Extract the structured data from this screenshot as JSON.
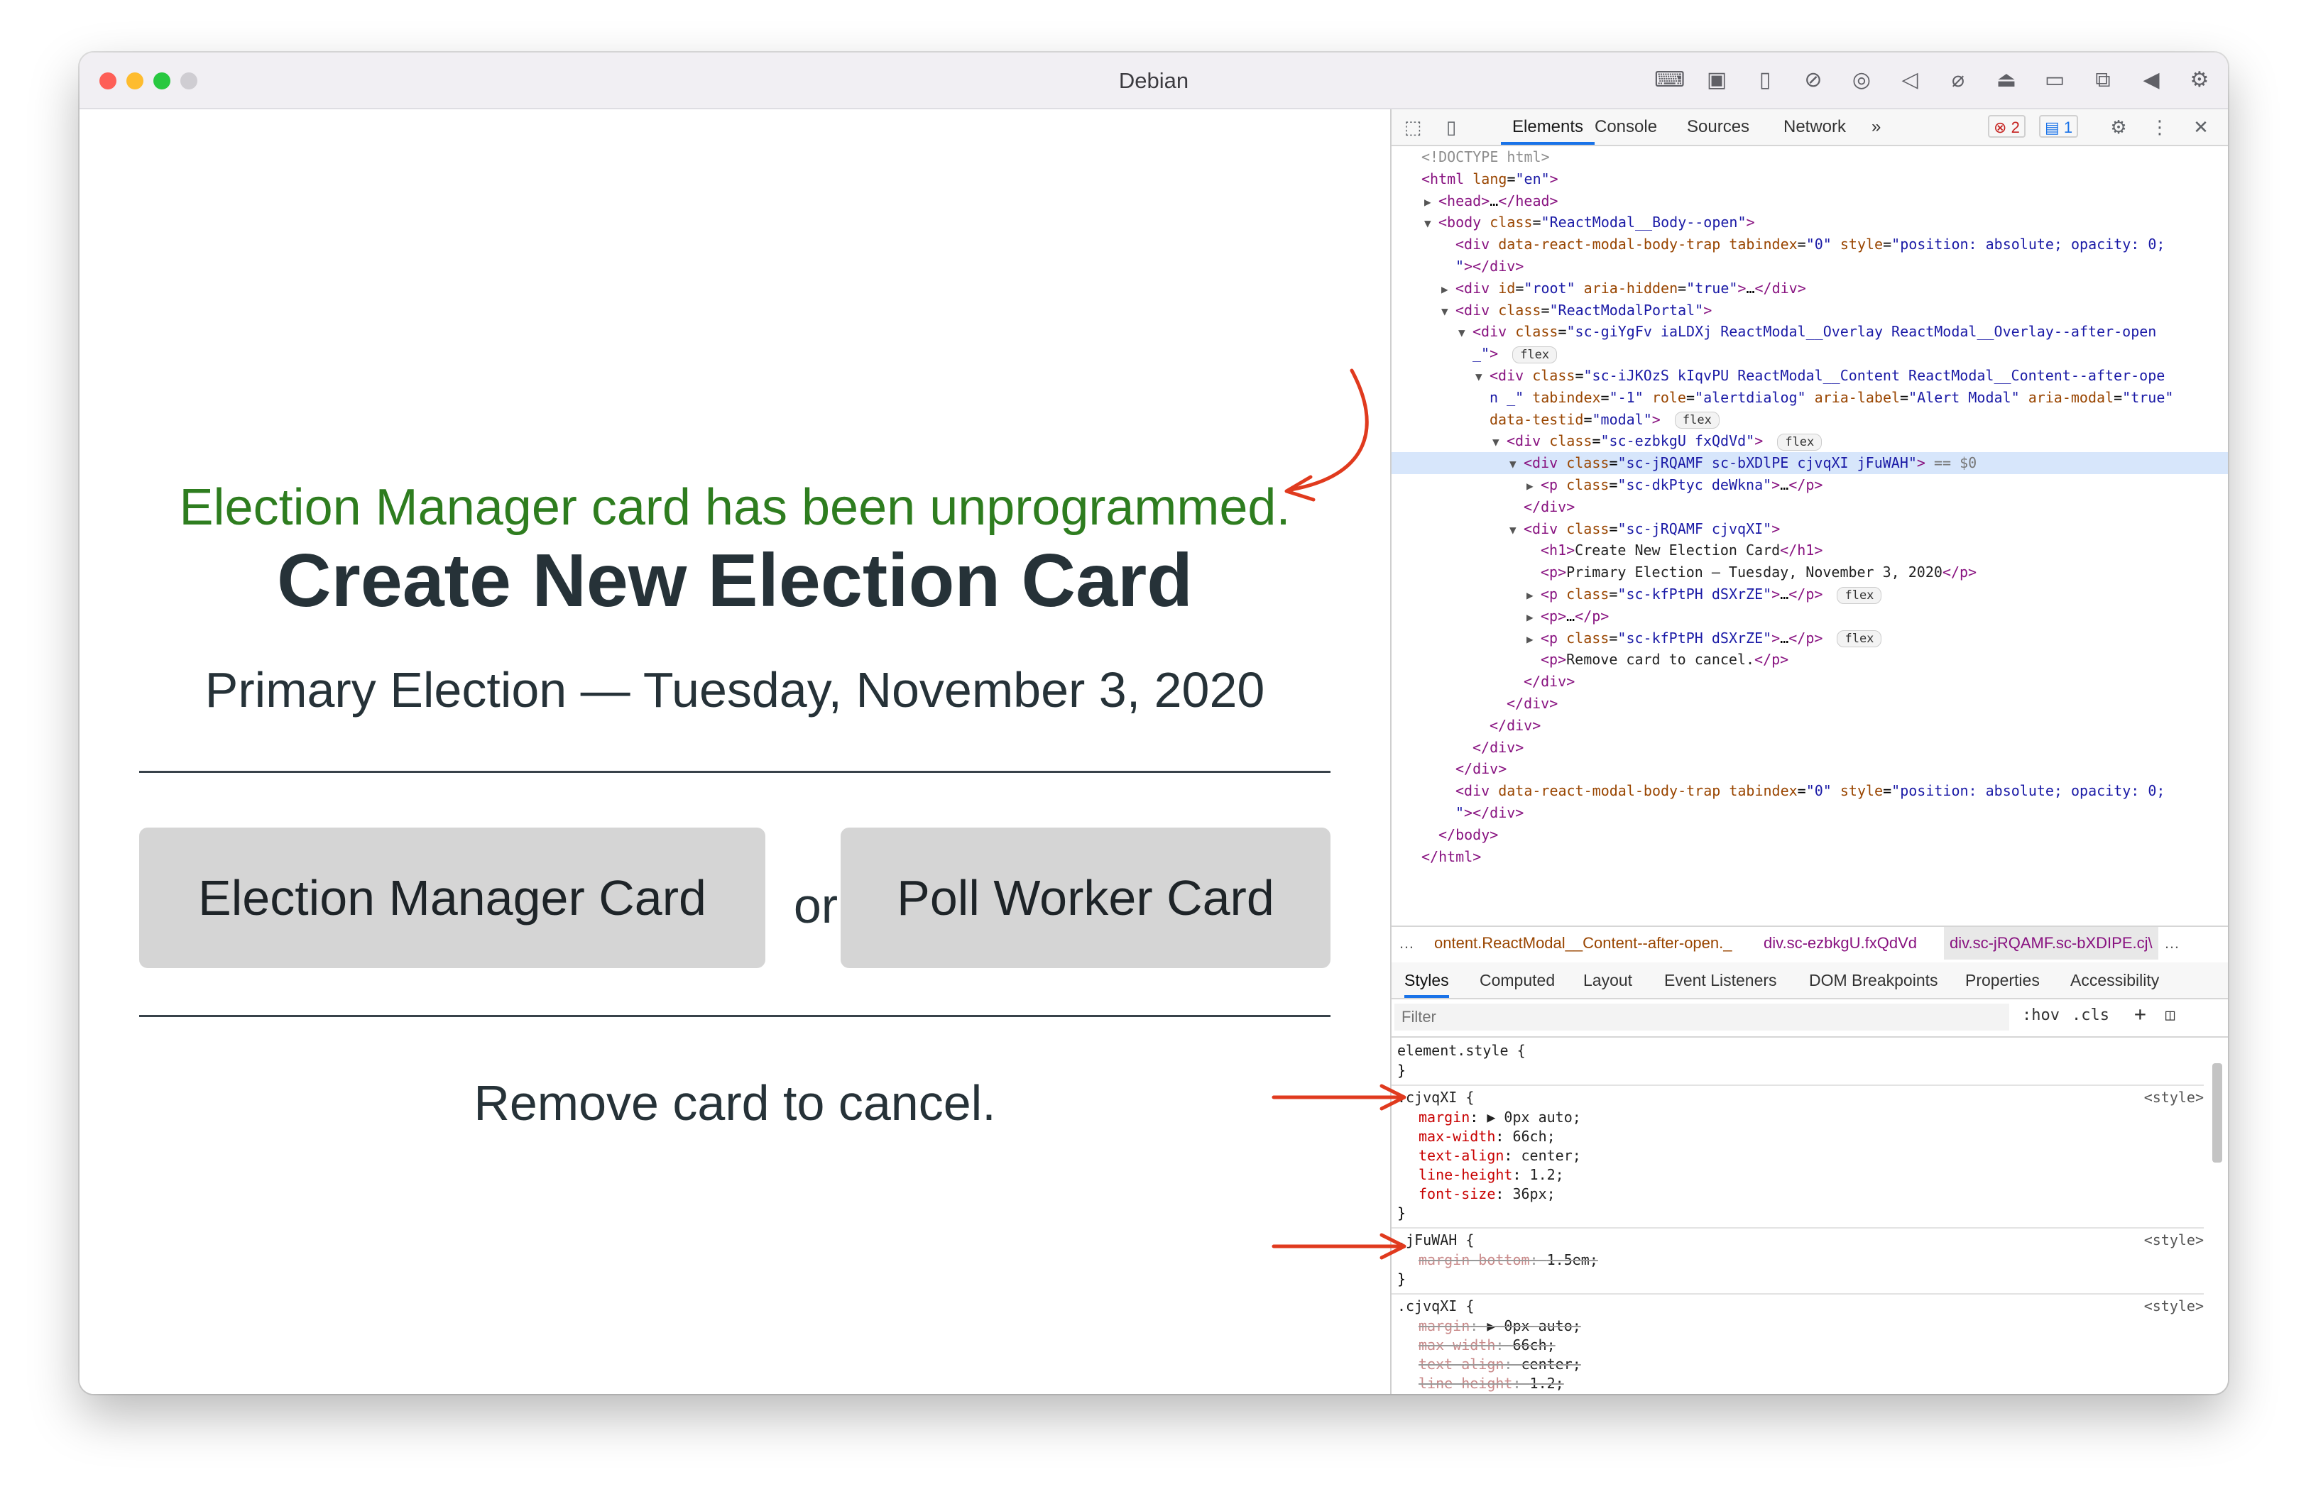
{
  "window": {
    "title": "Debian"
  },
  "titlebar_icons": [
    "keyboard-icon",
    "cpu-icon",
    "usb-icon",
    "display-off-icon",
    "network-icon",
    "speaker-icon",
    "microphone-off-icon",
    "drive-icon",
    "camera-off-icon",
    "screen-share-icon",
    "arrow-left-icon",
    "settings-icon"
  ],
  "app": {
    "success_message": "Election Manager card has been unprogrammed.",
    "heading": "Create New Election Card",
    "subtitle": "Primary Election — Tuesday, November 3, 2020",
    "election_manager_button": "Election Manager Card",
    "or_label": "or",
    "poll_worker_button": "Poll Worker Card",
    "cancel_instruction": "Remove card to cancel.",
    "success_color": "#2e7d1f",
    "button_bg": "#d5d5d5",
    "annotation_arrow_color": "#e03a1e"
  },
  "devtools": {
    "tabs": [
      "Elements",
      "Console",
      "Sources",
      "Network",
      "»"
    ],
    "active_tab": "Elements",
    "error_count": "2",
    "message_count": "1",
    "dom_lines": [
      {
        "indent": 0,
        "tri": "",
        "html": "<span class=\"tk-com\">&lt;!DOCTYPE html&gt;</span>"
      },
      {
        "indent": 0,
        "tri": "",
        "html": "<span class=\"tk-tag\">&lt;html</span> <span class=\"tk-attr\">lang</span>=<span class=\"tk-val\">\"en\"</span><span class=\"tk-tag\">&gt;</span>"
      },
      {
        "indent": 1,
        "tri": "▶",
        "html": "<span class=\"tk-tag\">&lt;head&gt;</span>…<span class=\"tk-tag\">&lt;/head&gt;</span>"
      },
      {
        "indent": 1,
        "tri": "▼",
        "html": "<span class=\"tk-tag\">&lt;body</span> <span class=\"tk-attr\">class</span>=<span class=\"tk-val\">\"ReactModal__Body--open\"</span><span class=\"tk-tag\">&gt;</span>"
      },
      {
        "indent": 2,
        "tri": "",
        "html": "<span class=\"tk-tag\">&lt;div</span> <span class=\"tk-attr\">data-react-modal-body-trap</span> <span class=\"tk-attr\">tabindex</span>=<span class=\"tk-val\">\"0\"</span> <span class=\"tk-attr\">style</span>=<span class=\"tk-val\">\"position: absolute; opacity: 0;</span>"
      },
      {
        "indent": 2,
        "tri": "",
        "html": "<span class=\"tk-val\">\"</span><span class=\"tk-tag\">&gt;&lt;/div&gt;</span>"
      },
      {
        "indent": 2,
        "tri": "▶",
        "html": "<span class=\"tk-tag\">&lt;div</span> <span class=\"tk-attr\">id</span>=<span class=\"tk-val\">\"root\"</span> <span class=\"tk-attr\">aria-hidden</span>=<span class=\"tk-val\">\"true\"</span><span class=\"tk-tag\">&gt;</span>…<span class=\"tk-tag\">&lt;/div&gt;</span>"
      },
      {
        "indent": 2,
        "tri": "▼",
        "html": "<span class=\"tk-tag\">&lt;div</span> <span class=\"tk-attr\">class</span>=<span class=\"tk-val\">\"ReactModalPortal\"</span><span class=\"tk-tag\">&gt;</span>"
      },
      {
        "indent": 3,
        "tri": "▼",
        "html": "<span class=\"tk-tag\">&lt;div</span> <span class=\"tk-attr\">class</span>=<span class=\"tk-val\">\"sc-giYgFv iaLDXj ReactModal__Overlay ReactModal__Overlay--after-open</span>"
      },
      {
        "indent": 3,
        "tri": "",
        "html": "<span class=\"tk-val\">_\"</span><span class=\"tk-tag\">&gt;</span> <span class=\"flex-pill\">flex</span>"
      },
      {
        "indent": 4,
        "tri": "▼",
        "html": "<span class=\"tk-tag\">&lt;div</span> <span class=\"tk-attr\">class</span>=<span class=\"tk-val\">\"sc-iJKOzS kIqvPU ReactModal__Content ReactModal__Content--after-ope</span>"
      },
      {
        "indent": 4,
        "tri": "",
        "html": "<span class=\"tk-val\">n _\"</span> <span class=\"tk-attr\">tabindex</span>=<span class=\"tk-val\">\"-1\"</span> <span class=\"tk-attr\">role</span>=<span class=\"tk-val\">\"alertdialog\"</span> <span class=\"tk-attr\">aria-label</span>=<span class=\"tk-val\">\"Alert Modal\"</span> <span class=\"tk-attr\">aria-modal</span>=<span class=\"tk-val\">\"true\"</span>"
      },
      {
        "indent": 4,
        "tri": "",
        "html": "<span class=\"tk-attr\">data-testid</span>=<span class=\"tk-val\">\"modal\"</span><span class=\"tk-tag\">&gt;</span> <span class=\"flex-pill\">flex</span>"
      },
      {
        "indent": 5,
        "tri": "▼",
        "html": "<span class=\"tk-tag\">&lt;div</span> <span class=\"tk-attr\">class</span>=<span class=\"tk-val\">\"sc-ezbkgU fxQdVd\"</span><span class=\"tk-tag\">&gt;</span> <span class=\"flex-pill\">flex</span>"
      },
      {
        "indent": 6,
        "tri": "▼",
        "sel": true,
        "html": "<span class=\"tk-tag\">&lt;div</span> <span class=\"tk-attr\">class</span>=<span class=\"tk-val\">\"sc-jRQAMF sc-bXDlPE cjvqXI jFuWAH\"</span><span class=\"tk-tag\">&gt;</span> <span class=\"sel-mark\">== $0</span>"
      },
      {
        "indent": 7,
        "tri": "▶",
        "html": "<span class=\"tk-tag\">&lt;p</span> <span class=\"tk-attr\">class</span>=<span class=\"tk-val\">\"sc-dkPtyc deWkna\"</span><span class=\"tk-tag\">&gt;</span>…<span class=\"tk-tag\">&lt;/p&gt;</span>"
      },
      {
        "indent": 6,
        "tri": "",
        "html": "<span class=\"tk-tag\">&lt;/div&gt;</span>"
      },
      {
        "indent": 6,
        "tri": "▼",
        "html": "<span class=\"tk-tag\">&lt;div</span> <span class=\"tk-attr\">class</span>=<span class=\"tk-val\">\"sc-jRQAMF cjvqXI\"</span><span class=\"tk-tag\">&gt;</span>"
      },
      {
        "indent": 7,
        "tri": "",
        "html": "<span class=\"tk-tag\">&lt;h1&gt;</span><span class=\"tk-text\">Create New Election Card</span><span class=\"tk-tag\">&lt;/h1&gt;</span>"
      },
      {
        "indent": 7,
        "tri": "",
        "html": "<span class=\"tk-tag\">&lt;p&gt;</span><span class=\"tk-text\">Primary Election — Tuesday, November 3, 2020</span><span class=\"tk-tag\">&lt;/p&gt;</span>"
      },
      {
        "indent": 7,
        "tri": "▶",
        "html": "<span class=\"tk-tag\">&lt;p</span> <span class=\"tk-attr\">class</span>=<span class=\"tk-val\">\"sc-kfPtPH dSXrZE\"</span><span class=\"tk-tag\">&gt;</span>…<span class=\"tk-tag\">&lt;/p&gt;</span> <span class=\"flex-pill\">flex</span>"
      },
      {
        "indent": 7,
        "tri": "▶",
        "html": "<span class=\"tk-tag\">&lt;p&gt;</span>…<span class=\"tk-tag\">&lt;/p&gt;</span>"
      },
      {
        "indent": 7,
        "tri": "▶",
        "html": "<span class=\"tk-tag\">&lt;p</span> <span class=\"tk-attr\">class</span>=<span class=\"tk-val\">\"sc-kfPtPH dSXrZE\"</span><span class=\"tk-tag\">&gt;</span>…<span class=\"tk-tag\">&lt;/p&gt;</span> <span class=\"flex-pill\">flex</span>"
      },
      {
        "indent": 7,
        "tri": "",
        "html": "<span class=\"tk-tag\">&lt;p&gt;</span><span class=\"tk-text\">Remove card to cancel.</span><span class=\"tk-tag\">&lt;/p&gt;</span>"
      },
      {
        "indent": 6,
        "tri": "",
        "html": "<span class=\"tk-tag\">&lt;/div&gt;</span>"
      },
      {
        "indent": 5,
        "tri": "",
        "html": "<span class=\"tk-tag\">&lt;/div&gt;</span>"
      },
      {
        "indent": 4,
        "tri": "",
        "html": "<span class=\"tk-tag\">&lt;/div&gt;</span>"
      },
      {
        "indent": 3,
        "tri": "",
        "html": "<span class=\"tk-tag\">&lt;/div&gt;</span>"
      },
      {
        "indent": 2,
        "tri": "",
        "html": "<span class=\"tk-tag\">&lt;/div&gt;</span>"
      },
      {
        "indent": 2,
        "tri": "",
        "html": "<span class=\"tk-tag\">&lt;div</span> <span class=\"tk-attr\">data-react-modal-body-trap</span> <span class=\"tk-attr\">tabindex</span>=<span class=\"tk-val\">\"0\"</span> <span class=\"tk-attr\">style</span>=<span class=\"tk-val\">\"position: absolute; opacity: 0;</span>"
      },
      {
        "indent": 2,
        "tri": "",
        "html": "<span class=\"tk-val\">\"</span><span class=\"tk-tag\">&gt;&lt;/div&gt;</span>"
      },
      {
        "indent": 1,
        "tri": "",
        "html": "<span class=\"tk-tag\">&lt;/body&gt;</span>"
      },
      {
        "indent": 0,
        "tri": "",
        "html": "<span class=\"tk-tag\">&lt;/html&gt;</span>"
      }
    ],
    "breadcrumbs": [
      "…",
      "ontent.ReactModal__Content--after-open._",
      "div.sc-ezbkgU.fxQdVd",
      "div.sc-jRQAMF.sc-bXDIPE.cj\\",
      "…"
    ],
    "subtabs": [
      "Styles",
      "Computed",
      "Layout",
      "Event Listeners",
      "DOM Breakpoints",
      "Properties",
      "Accessibility"
    ],
    "active_subtab": "Styles",
    "filter_placeholder": "Filter",
    "hov_label": ":hov",
    "cls_label": ".cls",
    "style_rules": [
      {
        "selector": "element.style {",
        "source": "",
        "props": []
      },
      {
        "selector": ".cjvqXI {",
        "source": "<style>",
        "props": [
          {
            "name": "margin",
            "value": "▶ 0px auto;",
            "struck": false
          },
          {
            "name": "max-width",
            "value": "66ch;",
            "struck": false
          },
          {
            "name": "text-align",
            "value": "center;",
            "struck": false
          },
          {
            "name": "line-height",
            "value": "1.2;",
            "struck": false
          },
          {
            "name": "font-size",
            "value": "36px;",
            "struck": false
          }
        ]
      },
      {
        "selector": ".jFuWAH {",
        "source": "<style>",
        "props": [
          {
            "name": "margin-bottom",
            "value": "1.5em;",
            "struck": true
          }
        ]
      },
      {
        "selector": ".cjvqXI {",
        "source": "<style>",
        "props": [
          {
            "name": "margin",
            "value": "▶ 0px auto;",
            "struck": true
          },
          {
            "name": "max-width",
            "value": "66ch;",
            "struck": true
          },
          {
            "name": "text-align",
            "value": "center;",
            "struck": true
          },
          {
            "name": "line-height",
            "value": "1.2;",
            "struck": true
          }
        ]
      }
    ]
  }
}
